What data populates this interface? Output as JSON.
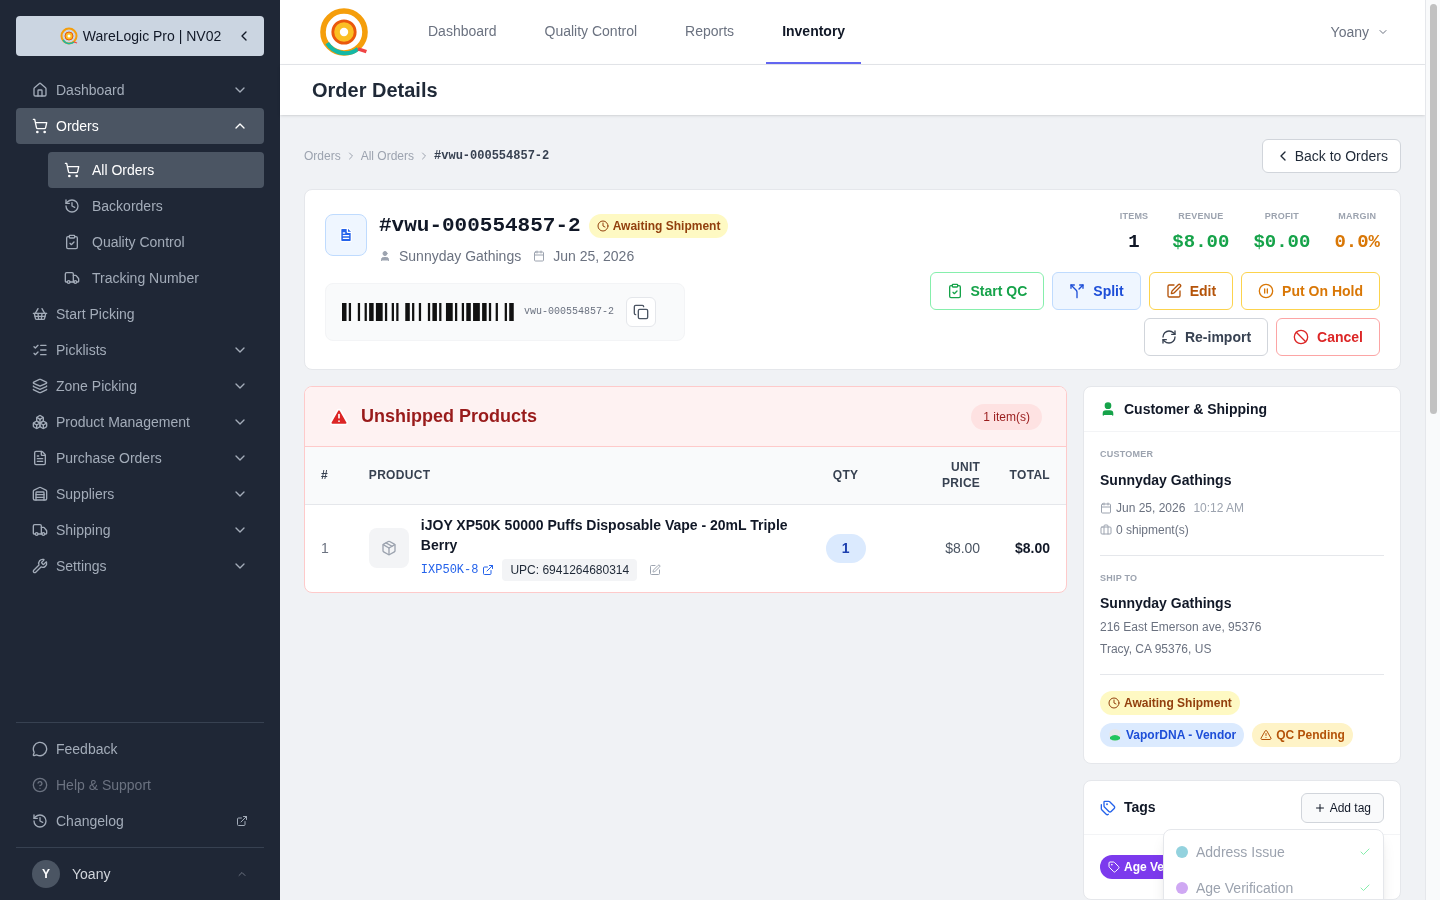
{
  "sidebar": {
    "brand": "WareLogic Pro | NV02",
    "items": [
      {
        "label": "Dashboard",
        "kind": "group",
        "expanded": false,
        "selected": false
      },
      {
        "label": "Orders",
        "kind": "group",
        "expanded": true,
        "selected": true,
        "children": [
          {
            "label": "All Orders",
            "selected": true
          },
          {
            "label": "Backorders",
            "selected": false
          },
          {
            "label": "Quality Control",
            "selected": false
          },
          {
            "label": "Tracking Number",
            "selected": false
          }
        ]
      },
      {
        "label": "Start Picking",
        "kind": "link",
        "selected": false
      },
      {
        "label": "Picklists",
        "kind": "group",
        "expanded": false,
        "selected": false
      },
      {
        "label": "Zone Picking",
        "kind": "group",
        "expanded": false,
        "selected": false
      },
      {
        "label": "Product Management",
        "kind": "group",
        "expanded": false,
        "selected": false
      },
      {
        "label": "Purchase Orders",
        "kind": "group",
        "expanded": false,
        "selected": false
      },
      {
        "label": "Suppliers",
        "kind": "group",
        "expanded": false,
        "selected": false
      },
      {
        "label": "Shipping",
        "kind": "group",
        "expanded": false,
        "selected": false
      },
      {
        "label": "Settings",
        "kind": "group",
        "expanded": false,
        "selected": false
      }
    ],
    "footer_links": [
      {
        "label": "Feedback",
        "disabled": false,
        "external": false
      },
      {
        "label": "Help & Support",
        "disabled": true,
        "external": false
      },
      {
        "label": "Changelog",
        "disabled": false,
        "external": true
      }
    ],
    "user": {
      "initial": "Y",
      "name": "Yoany"
    }
  },
  "top_nav": {
    "tabs": [
      {
        "label": "Dashboard",
        "selected": false
      },
      {
        "label": "Quality Control",
        "selected": false
      },
      {
        "label": "Reports",
        "selected": false
      },
      {
        "label": "Inventory",
        "selected": true
      }
    ],
    "user": "Yoany"
  },
  "page_title": "Order Details",
  "breadcrumb": [
    "Orders",
    "All Orders",
    "#vwu-000554857-2"
  ],
  "back_button": "Back to Orders",
  "order": {
    "number": "#vwu-000554857-2",
    "status": "Awaiting Shipment",
    "customer": "Sunnyday Gathings",
    "date": "Jun 25, 2026",
    "barcode_text": "vwu-000554857-2",
    "stats": [
      {
        "label": "ITEMS",
        "value": "1",
        "color": "#111827"
      },
      {
        "label": "REVENUE",
        "value": "$8.00",
        "color": "#16a34a"
      },
      {
        "label": "PROFIT",
        "value": "$0.00",
        "color": "#16a34a"
      },
      {
        "label": "MARGIN",
        "value": "0.0%",
        "color": "#d97706"
      }
    ],
    "actions": [
      {
        "label": "Start QC",
        "kind": "qc"
      },
      {
        "label": "Split",
        "kind": "split"
      },
      {
        "label": "Edit",
        "kind": "edit"
      },
      {
        "label": "Put On Hold",
        "kind": "hold"
      },
      {
        "label": "Re-import",
        "kind": "reimport"
      },
      {
        "label": "Cancel",
        "kind": "cancel"
      }
    ]
  },
  "unshipped": {
    "title": "Unshipped Products",
    "count": "1 item(s)",
    "columns": [
      "#",
      "PRODUCT",
      "QTY",
      "UNIT PRICE",
      "TOTAL"
    ],
    "rows": [
      {
        "index": "1",
        "name": "iJOY XP50K 50000 Puffs Disposable Vape - 20mL Triple Berry",
        "sku": "IXP50K-8",
        "upc": "UPC: 6941264680314",
        "qty": "1",
        "unit_price": "$8.00",
        "total": "$8.00"
      }
    ]
  },
  "customer_shipping": {
    "title": "Customer & Shipping",
    "customer_label": "CUSTOMER",
    "customer_name": "Sunnyday Gathings",
    "date": "Jun 25, 2026",
    "time": "10:12 AM",
    "shipments": "0 shipment(s)",
    "ship_to_label": "SHIP TO",
    "ship_name": "Sunnyday Gathings",
    "address_lines": [
      "216 East Emerson ave, 95376",
      "Tracy, CA 95376, US"
    ],
    "badges": [
      {
        "label": "Awaiting Shipment",
        "kind": "status"
      },
      {
        "label": "VaporDNA - Vendor",
        "kind": "vendor"
      },
      {
        "label": "QC Pending",
        "kind": "warning"
      }
    ]
  },
  "tags": {
    "title": "Tags",
    "add_button": "Add tag",
    "items": [
      {
        "label": "Age Ve",
        "color": "#7c3aed"
      }
    ],
    "dropdown": [
      {
        "label": "Address Issue",
        "color": "#93d2de",
        "selected": true
      },
      {
        "label": "Age Verification",
        "color": "#cfa8f3",
        "selected": true
      }
    ]
  }
}
